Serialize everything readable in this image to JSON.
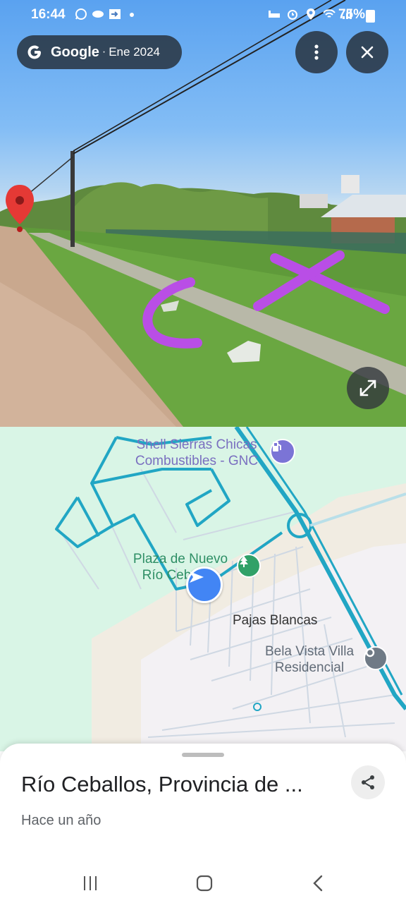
{
  "status_bar": {
    "time": "16:44",
    "battery": "75%",
    "left_icons": [
      "whatsapp-icon",
      "drive-icon",
      "cast-icon",
      "dot-icon"
    ],
    "right_icons": [
      "bed-icon",
      "alarm-icon",
      "location-icon",
      "wifi-icon",
      "signal-icon"
    ]
  },
  "streetview": {
    "brand": "Google",
    "separator": "·",
    "date": "Ene 2024"
  },
  "map": {
    "labels": {
      "shell": "Shell Sierras Chicas Combustibles - GNC",
      "plaza": "Plaza de Nuevo Río Ceballos",
      "pajas": "Pajas Blancas",
      "bela": "Bela Vista Villa Residencial"
    }
  },
  "sheet": {
    "title": "Río Ceballos, Provincia de ...",
    "subtitle": "Hace un año"
  },
  "colors": {
    "accent": "#4285f4",
    "map_road": "#21a6c4",
    "overlay_dark": "#28323e",
    "annotation": "#b94ee6"
  }
}
